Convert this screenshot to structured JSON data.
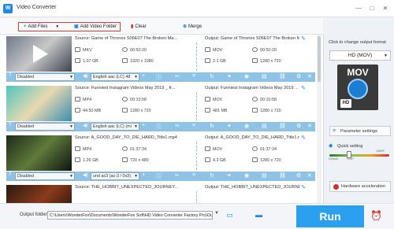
{
  "app": {
    "title": "Video Converter",
    "logo_char": "W"
  },
  "window_controls": [
    "—",
    "□",
    "✕"
  ],
  "toolbar": {
    "add_files": "Add Files",
    "add_video_folder": "Add Video Folder",
    "clear": "Clear",
    "merge": "Merge"
  },
  "files": [
    {
      "source": "Source: Game of Thrones S06E07 The Broken Ma...",
      "output": "Output: Game of Thrones S06E07 The Broken M...",
      "src_format": "MKV",
      "src_duration": "00:50:20",
      "src_size": "1.07 GB",
      "src_res": "1920 x 1080",
      "out_format": "MOV",
      "out_duration": "00:50:20",
      "out_size": "2.1 GB",
      "out_res": "1280 x 720",
      "subtitle": "Disabled",
      "audio": "English aac (LC) 48",
      "thumb_colors": [
        "#6f7a8a",
        "#c8c8c8",
        "#3c4350"
      ]
    },
    {
      "source": "Source: Funniest Instagram Videos May 2019 _ fr...",
      "output": "Output: Funniest Instagram Videos May 2019 ...",
      "src_format": "MP4",
      "src_duration": "00:10:58",
      "src_size": "44.50 MB",
      "src_res": "1280 x 720",
      "out_format": "MOV",
      "out_duration": "00:10:58",
      "out_size": "481 MB",
      "out_res": "1280 x 720",
      "subtitle": "Disabled",
      "audio": "English aac (LC) (mi",
      "thumb_colors": [
        "#4dc6c0",
        "#e8d9b0",
        "#3a8fb0"
      ]
    },
    {
      "source": "Source: A_GOOD_DAY_TO_DIE_HARD_Title1.mp4",
      "output": "Output: A_GOOD_DAY_TO_DIE_HARD_Title1.m...",
      "src_format": "MP4",
      "src_duration": "01:37:34",
      "src_size": "1.26 GB",
      "src_res": "720 x 480",
      "out_format": "MOV",
      "out_duration": "01:37:34",
      "out_size": "4.3 GB",
      "out_res": "1280 x 720",
      "subtitle": "Disabled",
      "audio": "und ac3 (ac-3 / 0x3)",
      "thumb_colors": [
        "#1d2a1a",
        "#5f7a3a",
        "#0e1410"
      ]
    },
    {
      "source": "Source: THE_HOBBIT_UNEXPECTED_JOURNEY...",
      "output": "Output: THE_HOBBIT_UNEXPECTED_JOURNEY...",
      "src_format": "",
      "src_duration": "",
      "src_size": "",
      "src_res": "",
      "out_format": "",
      "out_duration": "",
      "out_size": "",
      "out_res": "",
      "subtitle": "",
      "audio": "",
      "thumb_colors": [
        "#2a1a12",
        "#8a3a1a",
        "#1a0f0a"
      ]
    }
  ],
  "right_panel": {
    "hint": "Click to change output format",
    "format": "HD (MOV)",
    "icon_text": "MOV",
    "icon_badge": "HD",
    "parameter_settings": "Parameter settings",
    "quick_setting": "Quick setting",
    "quality_ticks": [
      "Default",
      "720P",
      "1080P"
    ],
    "quality_level": 0.33,
    "hardware_acceleration": "Hardware acceleration"
  },
  "bottom": {
    "output_folder_label": "Output folder:",
    "output_folder_path": "C:\\Users\\WonderFox\\Documents\\WonderFox Soft\\HD Video Converter Factory Pro\\OutputVideo\\",
    "run_label": "Run"
  },
  "colors": {
    "accent": "#2aa0ee",
    "highlight_box": "#e53935",
    "control_bar": "#8ec3e6"
  }
}
